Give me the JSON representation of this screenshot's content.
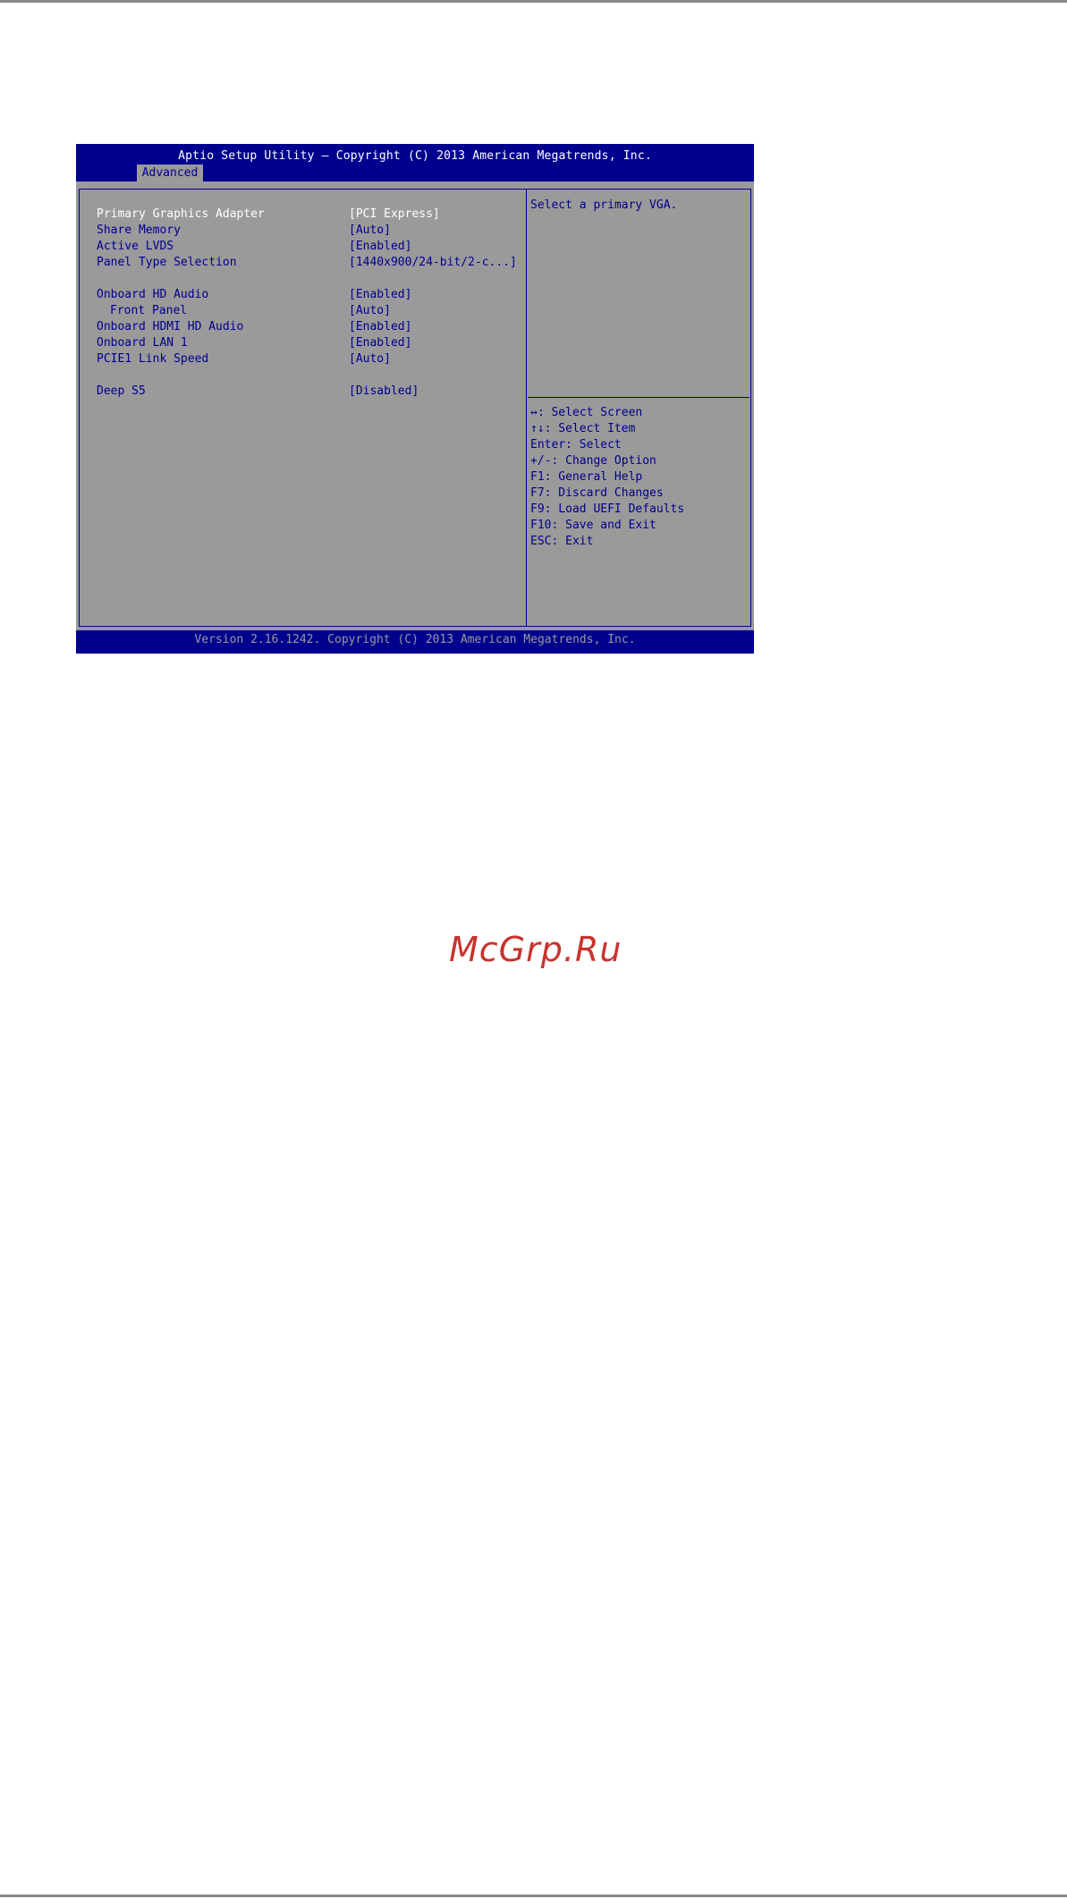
{
  "bios": {
    "title": "Aptio Setup Utility – Copyright (C) 2013 American Megatrends, Inc.",
    "active_tab": "Advanced",
    "footer": "Version 2.16.1242. Copyright (C) 2013 American Megatrends, Inc.",
    "settings": [
      {
        "label": "Primary Graphics Adapter",
        "value": "[PCI Express]",
        "selected": true
      },
      {
        "label": "Share Memory",
        "value": "[Auto]"
      },
      {
        "label": "Active LVDS",
        "value": "[Enabled]"
      },
      {
        "label": "Panel Type Selection",
        "value": "[1440x900/24-bit/2-c...]"
      },
      {
        "label": "Onboard HD Audio",
        "value": "[Enabled]"
      },
      {
        "label": "Front Panel",
        "value": "[Auto]"
      },
      {
        "label": "Onboard HDMI HD Audio",
        "value": "[Enabled]"
      },
      {
        "label": "Onboard LAN 1",
        "value": "[Enabled]"
      },
      {
        "label": "PCIE1 Link Speed",
        "value": "[Auto]"
      },
      {
        "label": "Deep S5",
        "value": "[Disabled]"
      }
    ],
    "help": "Select a primary VGA.",
    "key_help": [
      "↔: Select Screen",
      "↑↓: Select Item",
      "Enter: Select",
      "+/-: Change Option",
      "F1: General Help",
      "F7: Discard Changes",
      "F9: Load UEFI Defaults",
      "F10: Save and Exit",
      "ESC: Exit"
    ]
  },
  "watermark": "McGrp.Ru",
  "colors": {
    "bios_blue": "#00008f",
    "bios_gray": "#9a9a9a",
    "selected_text": "#ffffff",
    "watermark": "#c8332e"
  }
}
